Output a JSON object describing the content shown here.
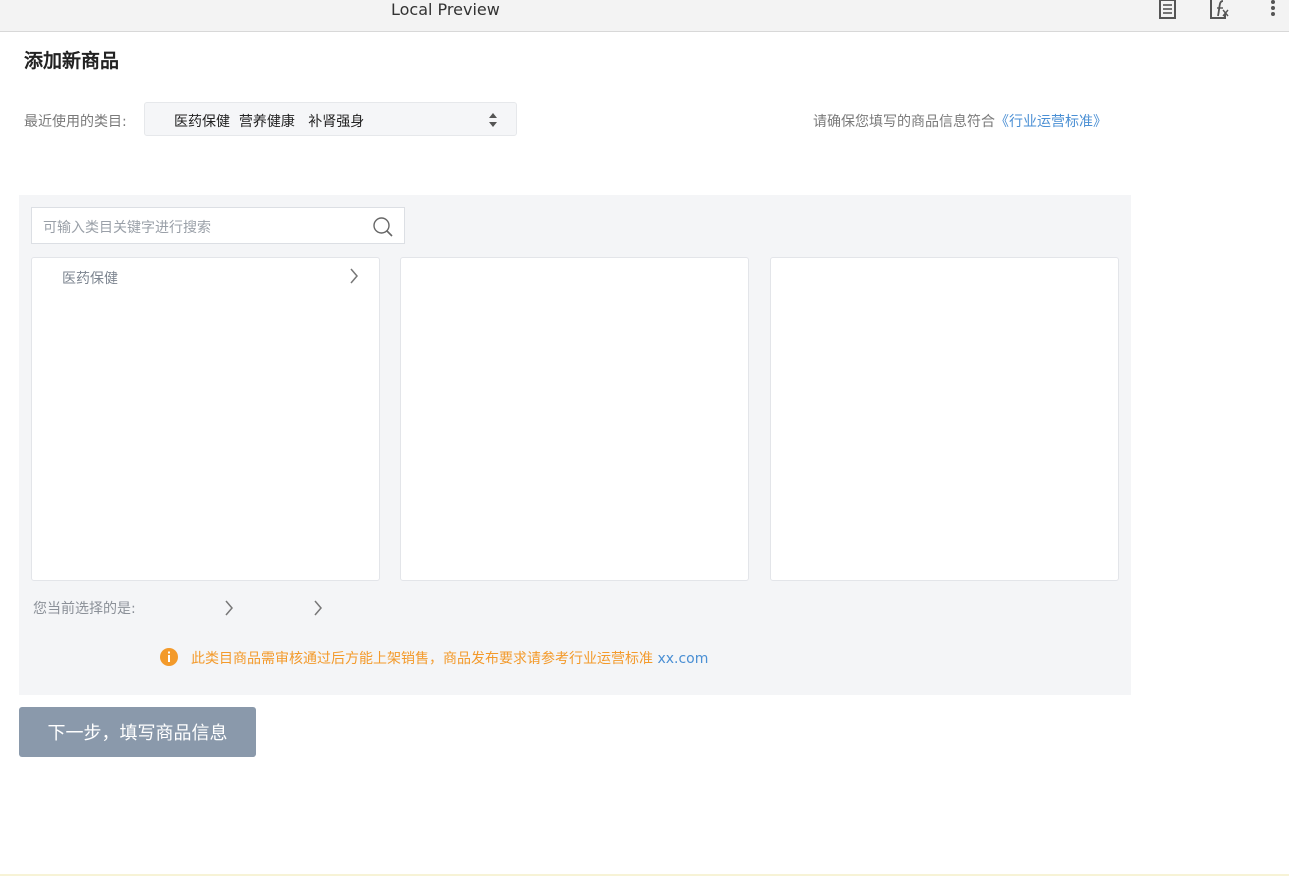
{
  "window": {
    "title": "Local Preview"
  },
  "toolbar": {
    "icons": [
      "document-icon",
      "formula-icon",
      "more-vertical-icon"
    ]
  },
  "page": {
    "title": "添加新商品"
  },
  "recent": {
    "label": "最近使用的类目:",
    "selected": "医药保健  营养健康   补肾强身"
  },
  "compliance": {
    "text": "请确保您填写的商品信息符合",
    "link": "《行业运营标准》"
  },
  "search": {
    "placeholder": "可输入类目关键字进行搜索"
  },
  "categories": {
    "level1": [
      {
        "label": "医药保健"
      }
    ],
    "level2": [],
    "level3": []
  },
  "selection": {
    "label": "您当前选择的是:"
  },
  "warning": {
    "text": "此类目商品需审核通过后方能上架销售，商品发布要求请参考行业运营标准",
    "link": "xx.com"
  },
  "actions": {
    "next_label": "下一步，填写商品信息"
  },
  "colors": {
    "accent_link": "#4a8fd4",
    "warning": "#f39a2b",
    "button_disabled": "#8a99ab",
    "panel_bg": "#f4f5f7"
  }
}
